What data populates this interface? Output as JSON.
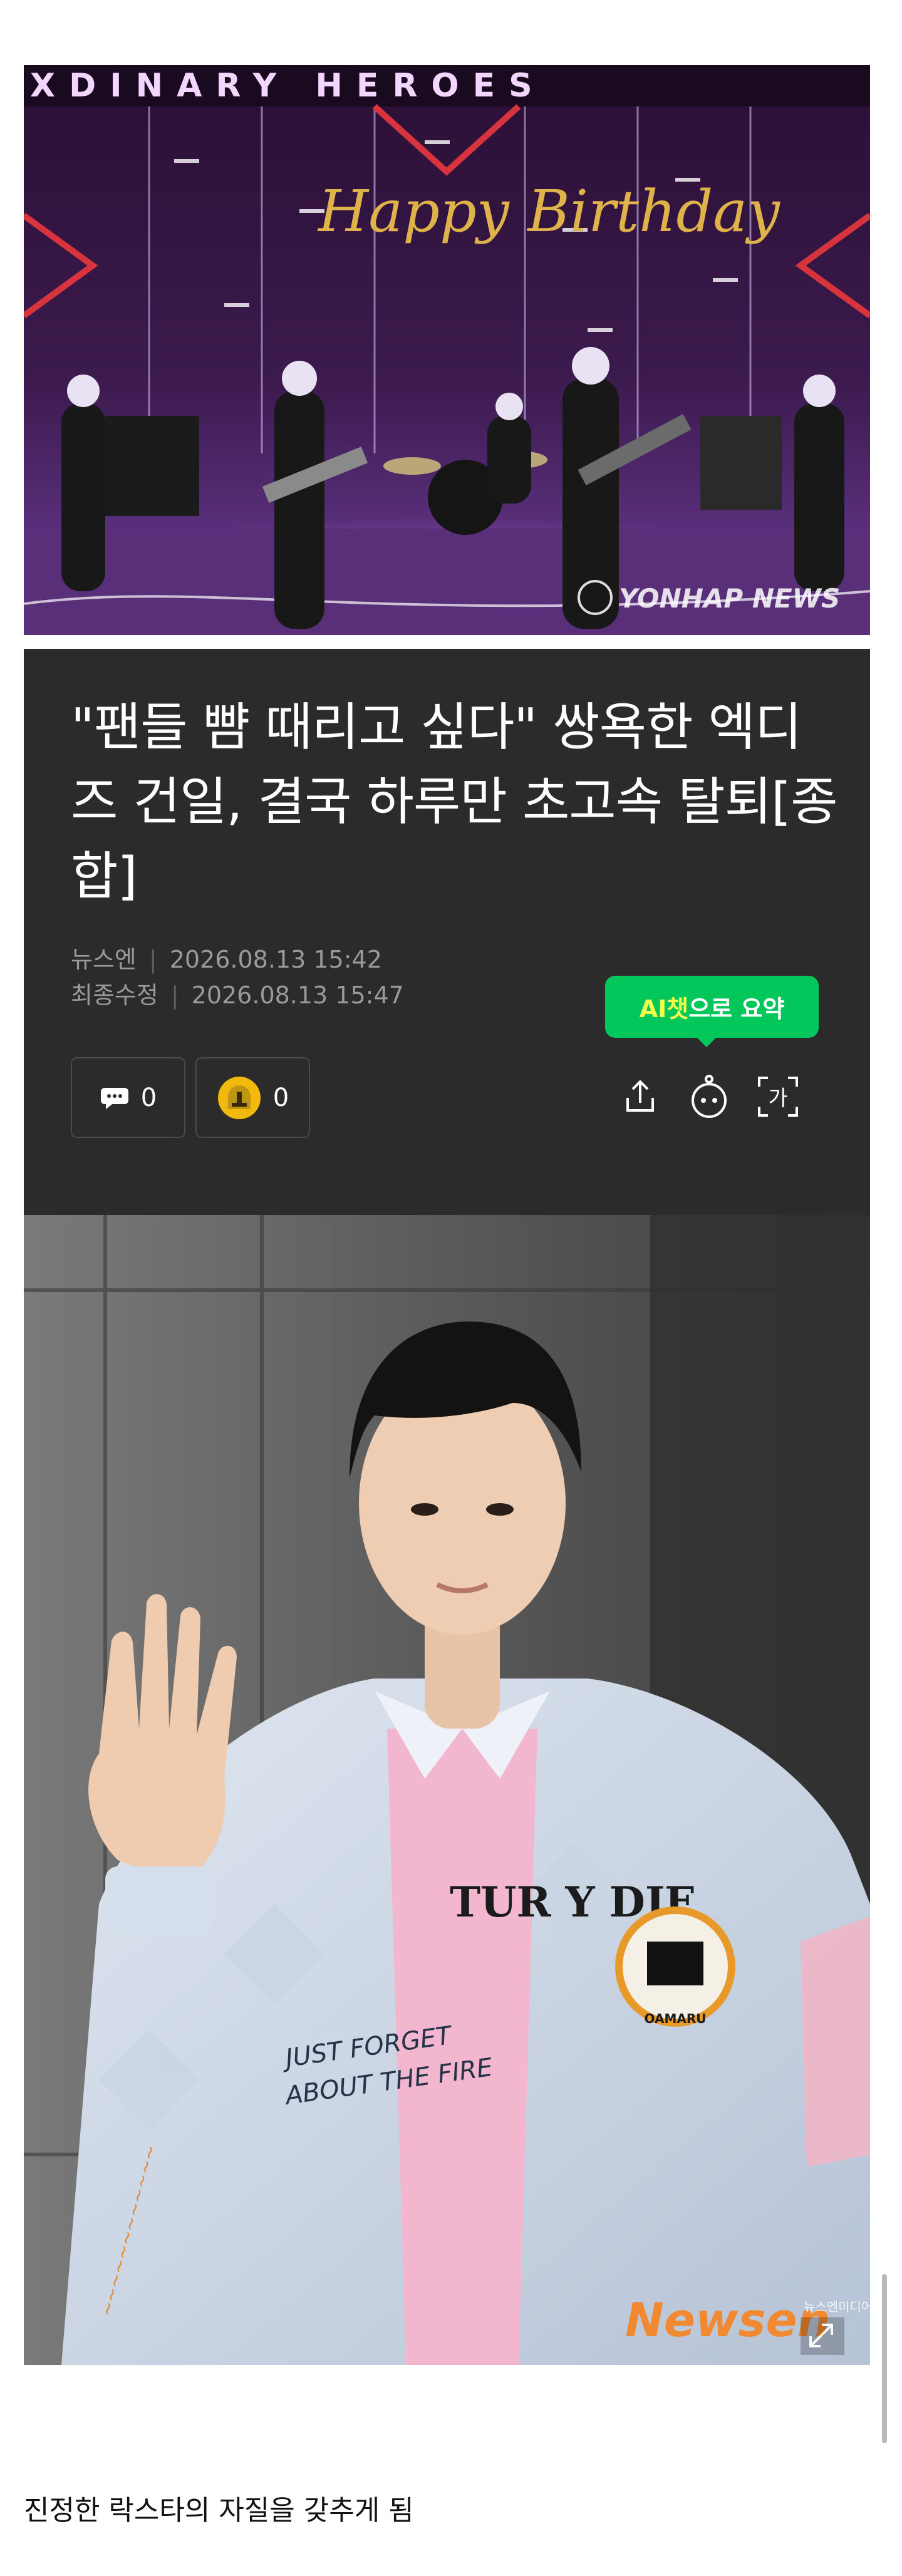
{
  "photo_top": {
    "sign_text": "XDINARY HEROES",
    "banner_text": "Happy Birthday",
    "watermark": "YONHAP NEWS"
  },
  "article": {
    "title": "\"팬들 뺨 때리고 싶다\" 쌍욕한 엑디즈 건일, 결국 하루만 초고속 탈퇴[종합]",
    "source": "뉴스엔",
    "published_label": "",
    "published": "2026.08.13 15:42",
    "updated_label": "최종수정",
    "updated": "2026.08.13 15:47",
    "ai_tip_highlight": "AI챗",
    "ai_tip_rest": "으로 요약",
    "comment_count": "0",
    "reaction_count": "0",
    "font_button_glyph": "가"
  },
  "photo_portrait": {
    "patch_text": "OAMARU",
    "print_text_1": "JUST FORGET",
    "print_text_2": "ABOUT THE FIRE",
    "shirt_text": "TUR Y DJE",
    "watermark": "Newsen",
    "watermark_small": "뉴스엔미디어"
  },
  "body": {
    "paragraph_1": "진정한 락스타의 자질을 갖추게 됨"
  },
  "colors": {
    "header_bg": "#2b2b2b",
    "ai_green": "#03c75a",
    "ai_highlight": "#f3ff4a",
    "meta_gray": "#9a9a9a"
  }
}
